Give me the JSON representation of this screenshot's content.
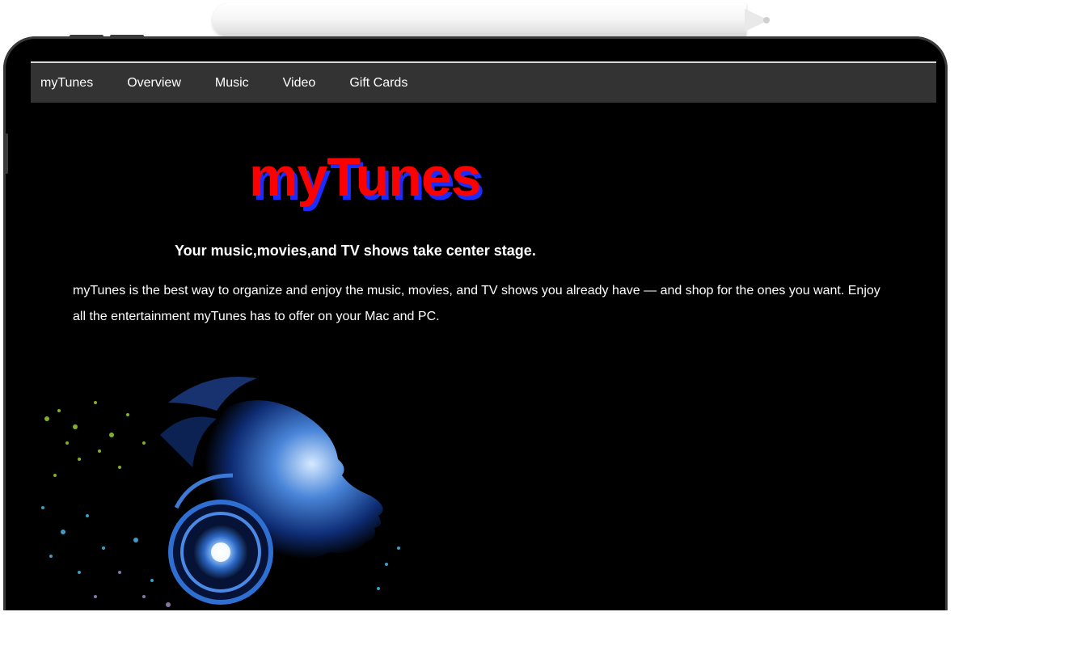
{
  "nav": {
    "items": [
      {
        "label": "myTunes"
      },
      {
        "label": "Overview"
      },
      {
        "label": "Music"
      },
      {
        "label": "Video"
      },
      {
        "label": "Gift Cards"
      }
    ]
  },
  "hero": {
    "title": "myTunes",
    "tagline": "Your music,movies,and TV shows take center stage.",
    "description": "myTunes is the best way to organize and enjoy the music, movies, and TV shows you already have — and shop for the ones you want. Enjoy all the entertainment myTunes has to offer on your Mac and PC."
  },
  "colors": {
    "title_red": "#ff0000",
    "title_shadow_blue": "#1a2cff",
    "navbar_bg": "#333333",
    "page_bg": "#000000"
  }
}
